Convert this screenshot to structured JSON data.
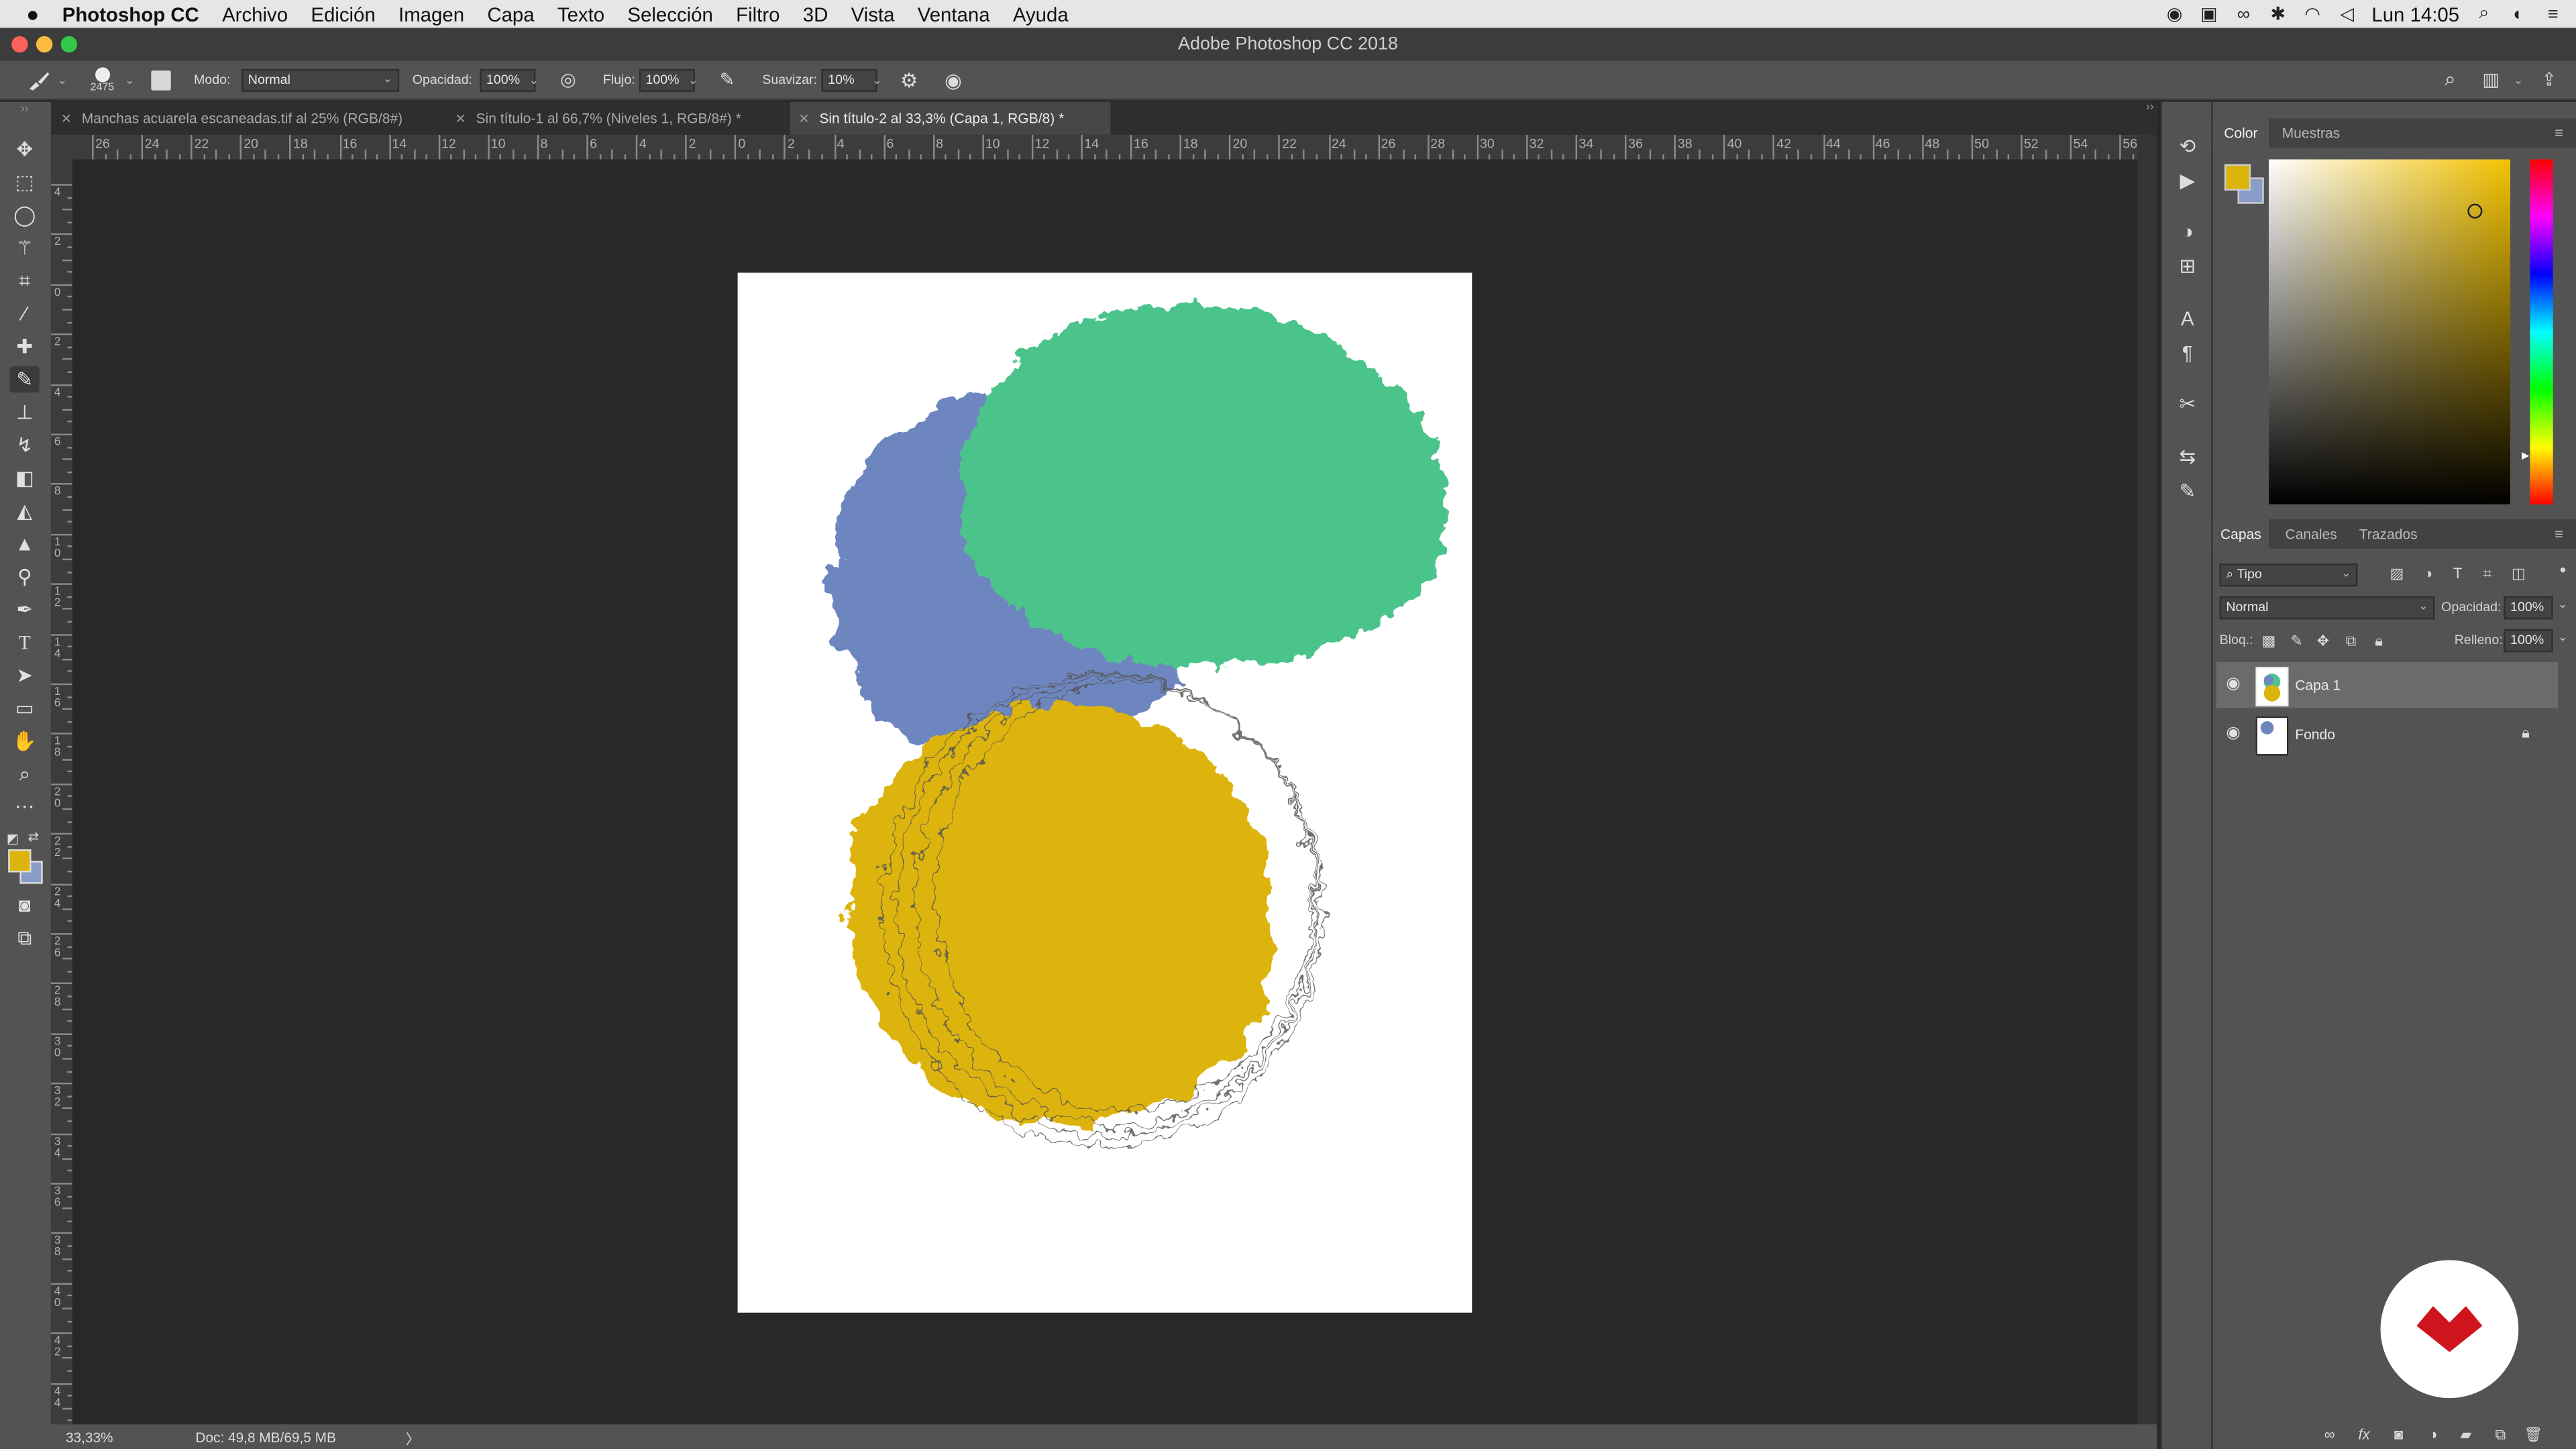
{
  "menubar": {
    "app_name": "Photoshop CC",
    "items": [
      "Archivo",
      "Edición",
      "Imagen",
      "Capa",
      "Texto",
      "Selección",
      "Filtro",
      "3D",
      "Vista",
      "Ventana",
      "Ayuda"
    ],
    "clock": "Lun 14:05"
  },
  "window": {
    "title": "Adobe Photoshop CC 2018"
  },
  "options": {
    "brush_size": "2475",
    "mode_label": "Modo:",
    "mode_value": "Normal",
    "opacity_label": "Opacidad:",
    "opacity_value": "100%",
    "flow_label": "Flujo:",
    "flow_value": "100%",
    "smooth_label": "Suavizar:",
    "smooth_value": "10%"
  },
  "tabs": [
    {
      "label": "Manchas acuarela escaneadas.tif al 25% (RGB/8#)"
    },
    {
      "label": "Sin título-1 al 66,7% (Niveles 1, RGB/8#) *"
    },
    {
      "label": "Sin título-2 al 33,3% (Capa 1, RGB/8) *"
    }
  ],
  "ruler": {
    "h_labels": [
      "26",
      "24",
      "22",
      "20",
      "18",
      "16",
      "14",
      "12",
      "10",
      "8",
      "6",
      "4",
      "2",
      "0",
      "2",
      "4",
      "6",
      "8",
      "10",
      "12",
      "14",
      "16",
      "18",
      "20",
      "22",
      "24",
      "26",
      "28",
      "30",
      "32",
      "34",
      "36",
      "38",
      "40",
      "42",
      "44",
      "46",
      "48",
      "50",
      "52",
      "54",
      "56"
    ],
    "v_labels": [
      "4",
      "2",
      "0",
      "2",
      "4",
      "6",
      "8",
      "10",
      "12",
      "14",
      "16",
      "18",
      "20",
      "22",
      "24",
      "26",
      "28",
      "30",
      "32",
      "34",
      "36",
      "38",
      "40",
      "42",
      "44"
    ]
  },
  "status": {
    "zoom": "33,33%",
    "doc": "Doc: 49,8 MB/69,5 MB",
    "arrow": "〉"
  },
  "color_panel": {
    "tabs": [
      "Color",
      "Muestras"
    ],
    "foreground": "#dcb40c",
    "background": "#8a9cc8"
  },
  "layers_panel": {
    "tabs": [
      "Capas",
      "Canales",
      "Trazados"
    ],
    "filter_label": "Tipo",
    "blend_mode": "Normal",
    "opacity_label": "Opacidad:",
    "opacity_value": "100%",
    "lock_label": "Bloq.:",
    "fill_label": "Relleno:",
    "fill_value": "100%",
    "layers": [
      {
        "name": "Capa 1",
        "selected": true
      },
      {
        "name": "Fondo",
        "selected": false
      }
    ]
  },
  "colors": {
    "green_blob": "#4cc48c",
    "blue_blob": "#6e86bf",
    "yellow_blob": "#dcb40c",
    "brand_red": "#d0141e"
  }
}
